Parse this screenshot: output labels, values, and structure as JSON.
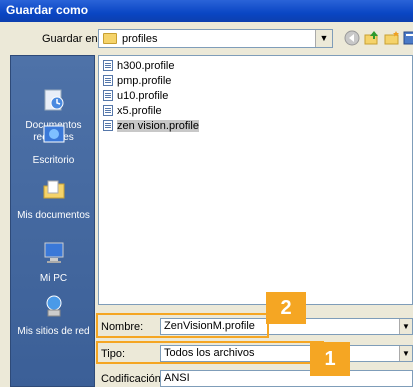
{
  "window": {
    "title": "Guardar como"
  },
  "lookin": {
    "label": "Guardar en:",
    "folder": "profiles"
  },
  "places": [
    {
      "label": "Documentos recientes"
    },
    {
      "label": "Escritorio"
    },
    {
      "label": "Mis documentos"
    },
    {
      "label": "Mi PC"
    },
    {
      "label": "Mis sitios de red"
    }
  ],
  "files": [
    {
      "name": "h300.profile"
    },
    {
      "name": "pmp.profile"
    },
    {
      "name": "u10.profile"
    },
    {
      "name": "x5.profile"
    },
    {
      "name": "zen vision.profile"
    }
  ],
  "form": {
    "filename_label": "Nombre:",
    "filename_value": "ZenVisionM.profile",
    "type_label": "Tipo:",
    "type_value": "Todos los archivos",
    "encoding_label": "Codificación:",
    "encoding_value": "ANSI"
  },
  "callouts": {
    "one": "1",
    "two": "2",
    "color": "#f5a623"
  }
}
